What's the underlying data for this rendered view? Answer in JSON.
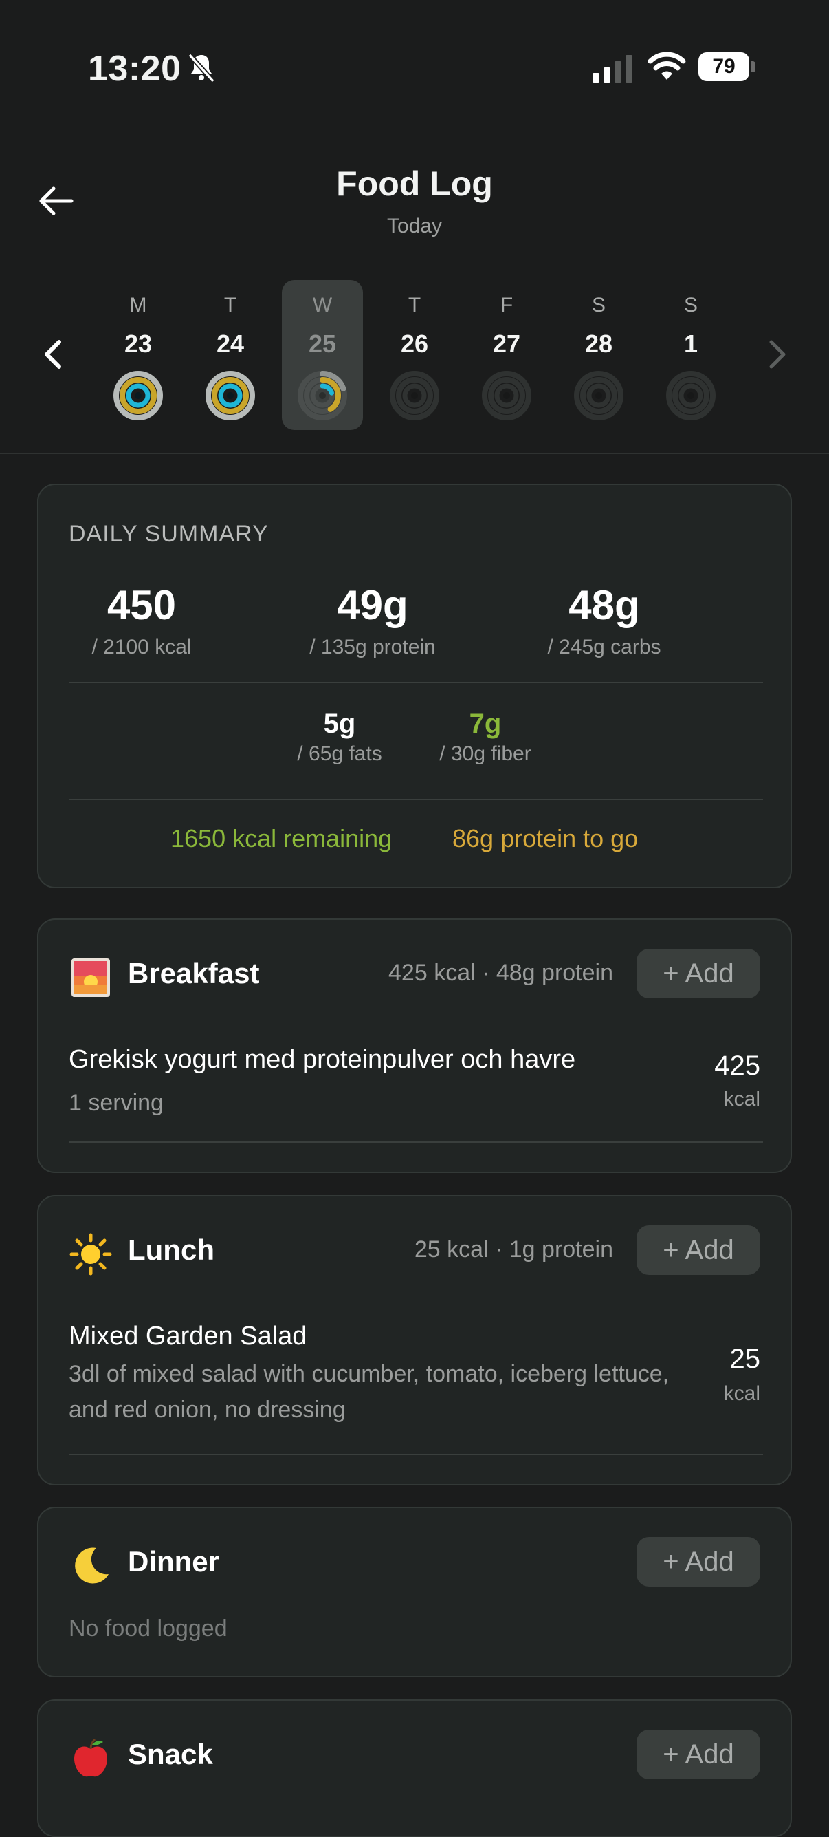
{
  "status": {
    "time": "13:20",
    "battery": "79"
  },
  "header": {
    "title": "Food Log",
    "subtitle": "Today"
  },
  "week": {
    "days": [
      {
        "dow": "M",
        "num": "23",
        "state": "full"
      },
      {
        "dow": "T",
        "num": "24",
        "state": "full"
      },
      {
        "dow": "W",
        "num": "25",
        "state": "partial",
        "selected": true
      },
      {
        "dow": "T",
        "num": "26",
        "state": "empty"
      },
      {
        "dow": "F",
        "num": "27",
        "state": "empty"
      },
      {
        "dow": "S",
        "num": "28",
        "state": "empty"
      },
      {
        "dow": "S",
        "num": "1",
        "state": "empty"
      }
    ]
  },
  "summary": {
    "label": "DAILY SUMMARY",
    "kcal": {
      "value": "450",
      "target": "/ 2100 kcal"
    },
    "protein": {
      "value": "49g",
      "target": "/ 135g protein"
    },
    "carbs": {
      "value": "48g",
      "target": "/ 245g carbs"
    },
    "fats": {
      "value": "5g",
      "target": "/ 65g fats"
    },
    "fiber": {
      "value": "7g",
      "target": "/ 30g fiber"
    },
    "remaining_kcal": "1650 kcal remaining",
    "protein_to_go": "86g protein to go"
  },
  "meals": {
    "breakfast": {
      "title": "Breakfast",
      "totals": "425 kcal · 48g protein",
      "add_label": "+ Add",
      "icon": "sunrise-icon",
      "item": {
        "name": "Grekisk yogurt med proteinpulver och havre",
        "desc": "1 serving",
        "kcal": "425",
        "unit": "kcal"
      }
    },
    "lunch": {
      "title": "Lunch",
      "totals": "25 kcal · 1g protein",
      "add_label": "+ Add",
      "icon": "sun-icon",
      "item": {
        "name": "Mixed Garden Salad",
        "desc": "3dl of mixed salad with cucumber, tomato, iceberg lettuce, and red onion, no dressing",
        "kcal": "25",
        "unit": "kcal"
      }
    },
    "dinner": {
      "title": "Dinner",
      "add_label": "+ Add",
      "icon": "moon-icon",
      "empty": "No food logged"
    },
    "snack": {
      "title": "Snack",
      "add_label": "+ Add",
      "icon": "apple-icon"
    }
  },
  "colors": {
    "accent_green": "#8bb83a",
    "accent_gold": "#d8a93a",
    "ring_teal": "#1fb6d6"
  }
}
